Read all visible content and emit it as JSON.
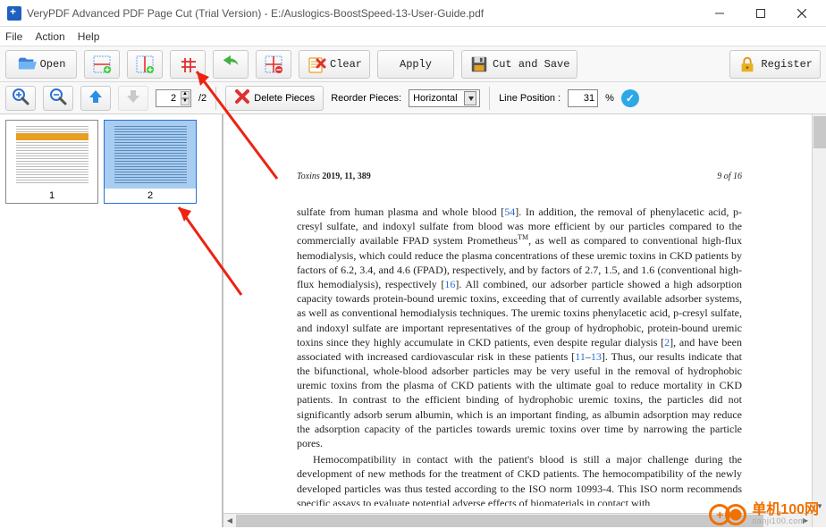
{
  "title": "VeryPDF Advanced PDF Page Cut (Trial Version) - E:/Auslogics-BoostSpeed-13-User-Guide.pdf",
  "menu": {
    "file": "File",
    "action": "Action",
    "help": "Help"
  },
  "toolbar": {
    "open": "Open",
    "clear": "Clear",
    "apply": "Apply",
    "cut_and_save": "Cut and Save",
    "register": "Register"
  },
  "toolbar2": {
    "page_current": "2",
    "page_total": "/2",
    "delete_pieces": "Delete Pieces",
    "reorder_label": "Reorder Pieces:",
    "reorder_value": "Horizontal",
    "line_pos_label": "Line Position :",
    "line_pos_value": "31",
    "line_pos_unit": "%"
  },
  "thumbs": {
    "p1": "1",
    "p2": "2"
  },
  "doc": {
    "header_left_a": "Toxins",
    "header_left_b": " 2019, 11, 389",
    "header_right": "9 of 16",
    "body": "sulfate from human plasma and whole blood [54]. In addition, the removal of phenylacetic acid, p-cresyl sulfate, and indoxyl sulfate from blood was more efficient by our particles compared to the commercially available FPAD system PrometheusTM, as well as compared to conventional high-flux hemodialysis, which could reduce the plasma concentrations of these uremic toxins in CKD patients by factors of 6.2, 3.4, and 4.6 (FPAD), respectively, and by factors of 2.7, 1.5, and 1.6 (conventional high-flux hemodialysis), respectively [16]. All combined, our adsorber particle showed a high adsorption capacity towards protein-bound uremic toxins, exceeding that of currently available adsorber systems, as well as conventional hemodialysis techniques. The uremic toxins phenylacetic acid, p-cresyl sulfate, and indoxyl sulfate are important representatives of the group of hydrophobic, protein-bound uremic toxins since they highly accumulate in CKD patients, even despite regular dialysis [2], and have been associated with increased cardiovascular risk in these patients [11–13]. Thus, our results indicate that the bifunctional, whole-blood adsorber particles may be very useful in the removal of hydrophobic uremic toxins from the plasma of CKD patients with the ultimate goal to reduce mortality in CKD patients. In contrast to the efficient binding of hydrophobic uremic toxins, the particles did not significantly adsorb serum albumin, which is an important finding, as albumin adsorption may reduce the adsorption capacity of the particles towards uremic toxins over time by narrowing the particle pores.",
    "body2": "Hemocompatibility in contact with the patient's blood is still a major challenge during the development of new methods for the treatment of CKD patients. The hemocompatibility of the newly developed particles was thus tested according to the ISO norm 10993-4. This ISO norm recommends specific assays to evaluate potential adverse effects of biomaterials in contact with"
  },
  "watermark": {
    "main": "单机100网",
    "sub": "danji100.com"
  }
}
